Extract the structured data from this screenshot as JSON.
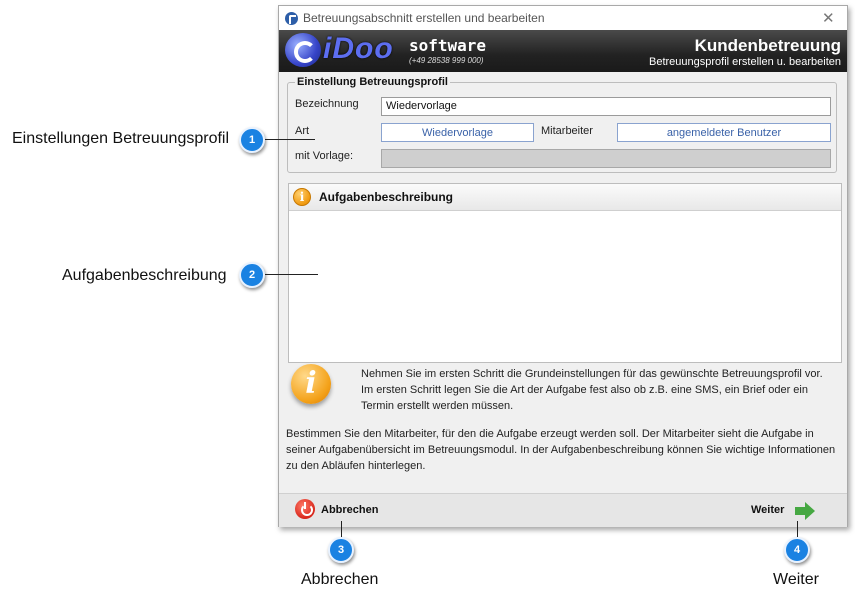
{
  "window": {
    "title": "Betreuungsabschnitt erstellen und bearbeiten",
    "close_glyph": "✕"
  },
  "banner": {
    "logo_text": "iDoo",
    "logo_software": "software",
    "logo_phone": "(+49 28538 999 000)",
    "title": "Kundenbetreuung",
    "subtitle": "Betreuungsprofil erstellen u. bearbeiten"
  },
  "profile": {
    "group_title": "Einstellung Betreuungsprofil",
    "bezeichnung_label": "Bezeichnung",
    "bezeichnung_value": "Wiedervorlage",
    "art_label": "Art",
    "art_value": "Wiedervorlage",
    "mitarbeiter_label": "Mitarbeiter",
    "mitarbeiter_value": "angemeldeter Benutzer",
    "vorlage_label": "mit Vorlage:",
    "vorlage_value": ""
  },
  "task_panel": {
    "title": "Aufgabenbeschreibung",
    "info_glyph": "i"
  },
  "info": {
    "glyph": "i",
    "paragraph1": "Nehmen Sie im ersten Schritt die Grundeinstellungen für das gewünschte Betreuungsprofil vor. Im ersten Schritt legen Sie die Art der Aufgabe fest also ob z.B. eine SMS, ein Brief oder ein Termin erstellt werden müssen.",
    "paragraph2": "Bestimmen Sie den Mitarbeiter, für den die Aufgabe erzeugt werden soll. Der Mitarbeiter sieht die Aufgabe in seiner Aufgabenübersicht im Betreuungsmodul. In der Aufgabenbeschreibung können Sie wichtige Informationen zu den Abläufen hinterlegen."
  },
  "footer": {
    "cancel_label": "Abbrechen",
    "next_label": "Weiter"
  },
  "callouts": [
    {
      "number": "1",
      "label": "Einstellungen Betreuungsprofil"
    },
    {
      "number": "2",
      "label": "Aufgabenbeschreibung"
    },
    {
      "number": "3",
      "label": "Abbrechen"
    },
    {
      "number": "4",
      "label": "Weiter"
    }
  ],
  "colors": {
    "callout": "#1a82e2",
    "banner": "#222222",
    "accent_link": "#3a62a8"
  }
}
